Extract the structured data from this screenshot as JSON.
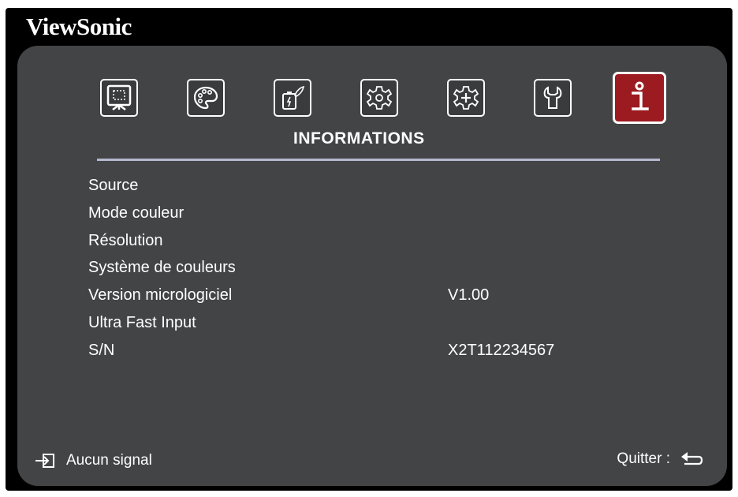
{
  "brand": "ViewSonic",
  "menu_title": "INFORMATIONS",
  "tabs": [
    {
      "icon": "display-icon",
      "active": false
    },
    {
      "icon": "palette-icon",
      "active": false
    },
    {
      "icon": "power-settings-icon",
      "active": false
    },
    {
      "icon": "basic-settings-icon",
      "active": false
    },
    {
      "icon": "advanced-settings-icon",
      "active": false
    },
    {
      "icon": "wrench-icon",
      "active": false
    },
    {
      "icon": "info-icon",
      "active": true
    }
  ],
  "rows": [
    {
      "label": "Source",
      "value": ""
    },
    {
      "label": "Mode couleur",
      "value": ""
    },
    {
      "label": "Résolution",
      "value": ""
    },
    {
      "label": "Système de couleurs",
      "value": ""
    },
    {
      "label": "Version micrologiciel",
      "value": "V1.00"
    },
    {
      "label": "Ultra Fast Input",
      "value": ""
    },
    {
      "label": "S/N",
      "value": "X2T112234567"
    }
  ],
  "footer": {
    "signal_icon": "input-source-icon",
    "signal_text": "Aucun signal",
    "quit_label": "Quitter :",
    "quit_icon": "return-arrow-icon"
  },
  "colors": {
    "panel": "#434446",
    "active_tab": "#9b1b20",
    "divider": "#b4b9cf"
  }
}
